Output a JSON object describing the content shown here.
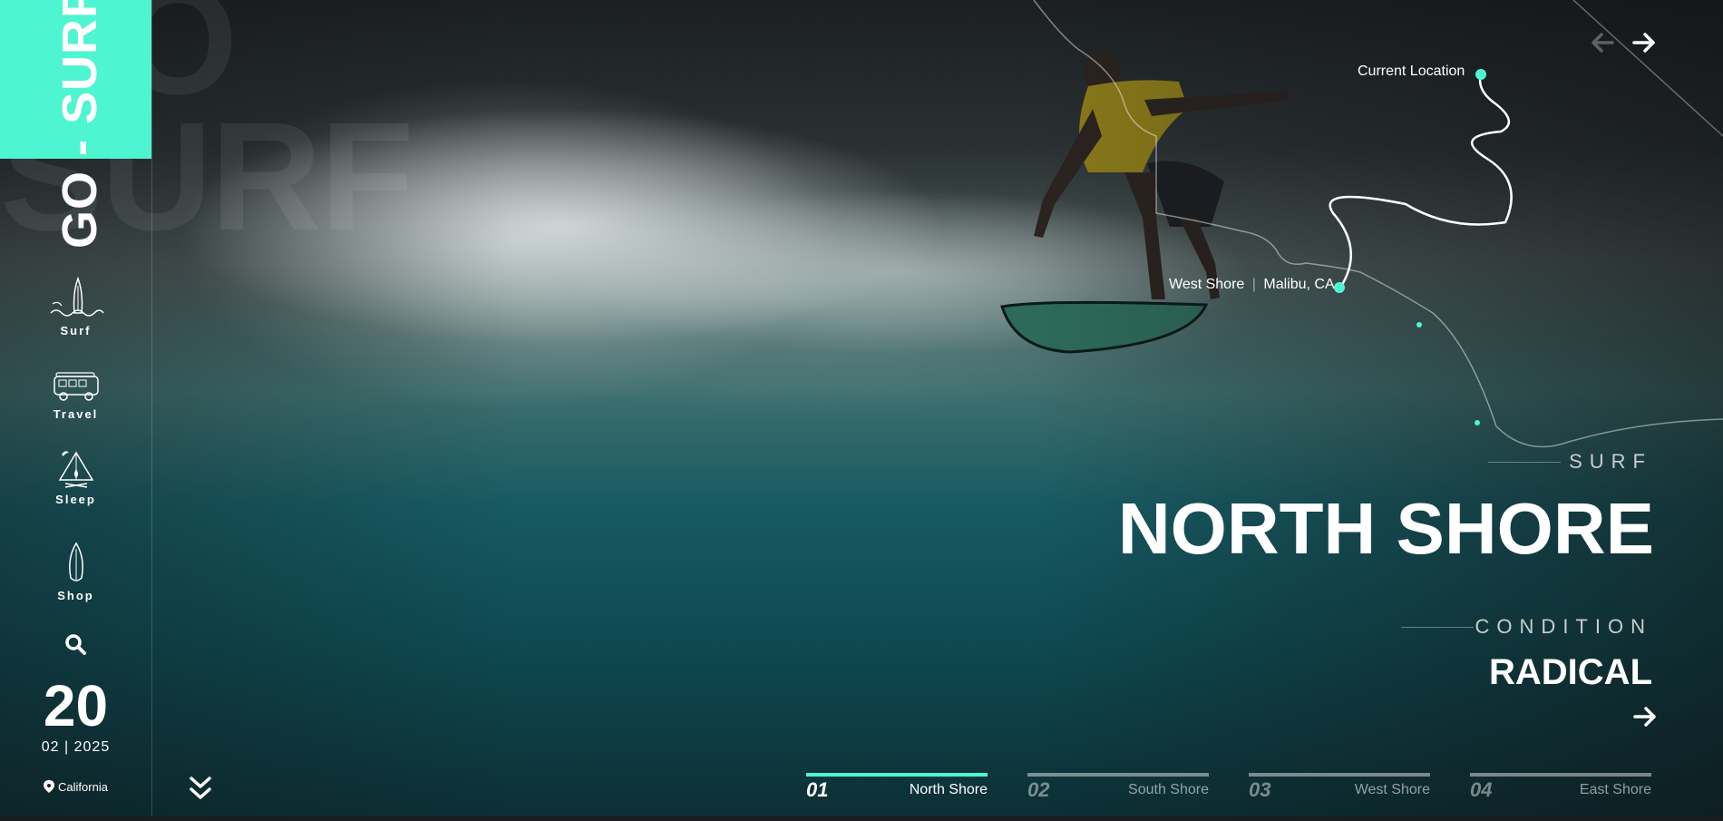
{
  "brand": {
    "logo_text": "GO - SURF",
    "background_text": "GO\nSURF",
    "accent_color": "#4df5d0"
  },
  "sidebar": {
    "nav": [
      {
        "label": "Surf",
        "icon": "surfboard-wave-icon"
      },
      {
        "label": "Travel",
        "icon": "van-icon"
      },
      {
        "label": "Sleep",
        "icon": "tent-campfire-icon"
      },
      {
        "label": "Shop",
        "icon": "surfboard-icon"
      }
    ],
    "search_icon": "search-icon",
    "date": {
      "day": "20",
      "month_year": "02 | 2025"
    },
    "location": "California"
  },
  "map": {
    "current_location_label": "Current Location",
    "spot_name": "West Shore",
    "spot_place": "Malibu, CA"
  },
  "hero": {
    "category": "SURF",
    "title": "NORTH SHORE",
    "condition_label": "CONDITION",
    "condition_value": "RADICAL"
  },
  "tabs": [
    {
      "num": "01",
      "name": "North Shore",
      "active": true
    },
    {
      "num": "02",
      "name": "South Shore",
      "active": false
    },
    {
      "num": "03",
      "name": "West Shore",
      "active": false
    },
    {
      "num": "04",
      "name": "East Shore",
      "active": false
    }
  ]
}
